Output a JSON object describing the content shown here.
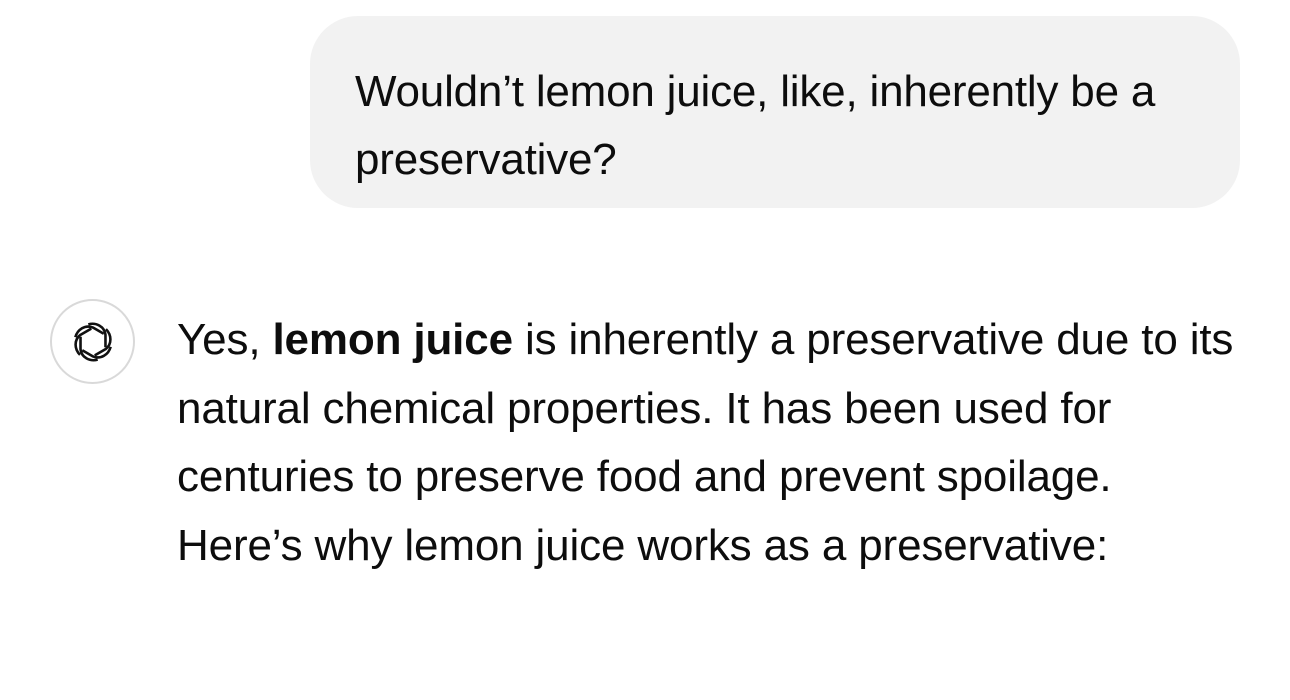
{
  "user_message": {
    "text": "Wouldn’t lemon juice, like, inherently be a preservative?"
  },
  "assistant": {
    "avatar_icon": "openai-logo-icon",
    "message": {
      "prefix": "Yes, ",
      "bold": "lemon juice",
      "body": " is inherently a preservative due to its natural chemical properties. It has been used for centuries to preserve food and prevent spoilage. Here’s why lemon juice works as a preservative:"
    }
  }
}
